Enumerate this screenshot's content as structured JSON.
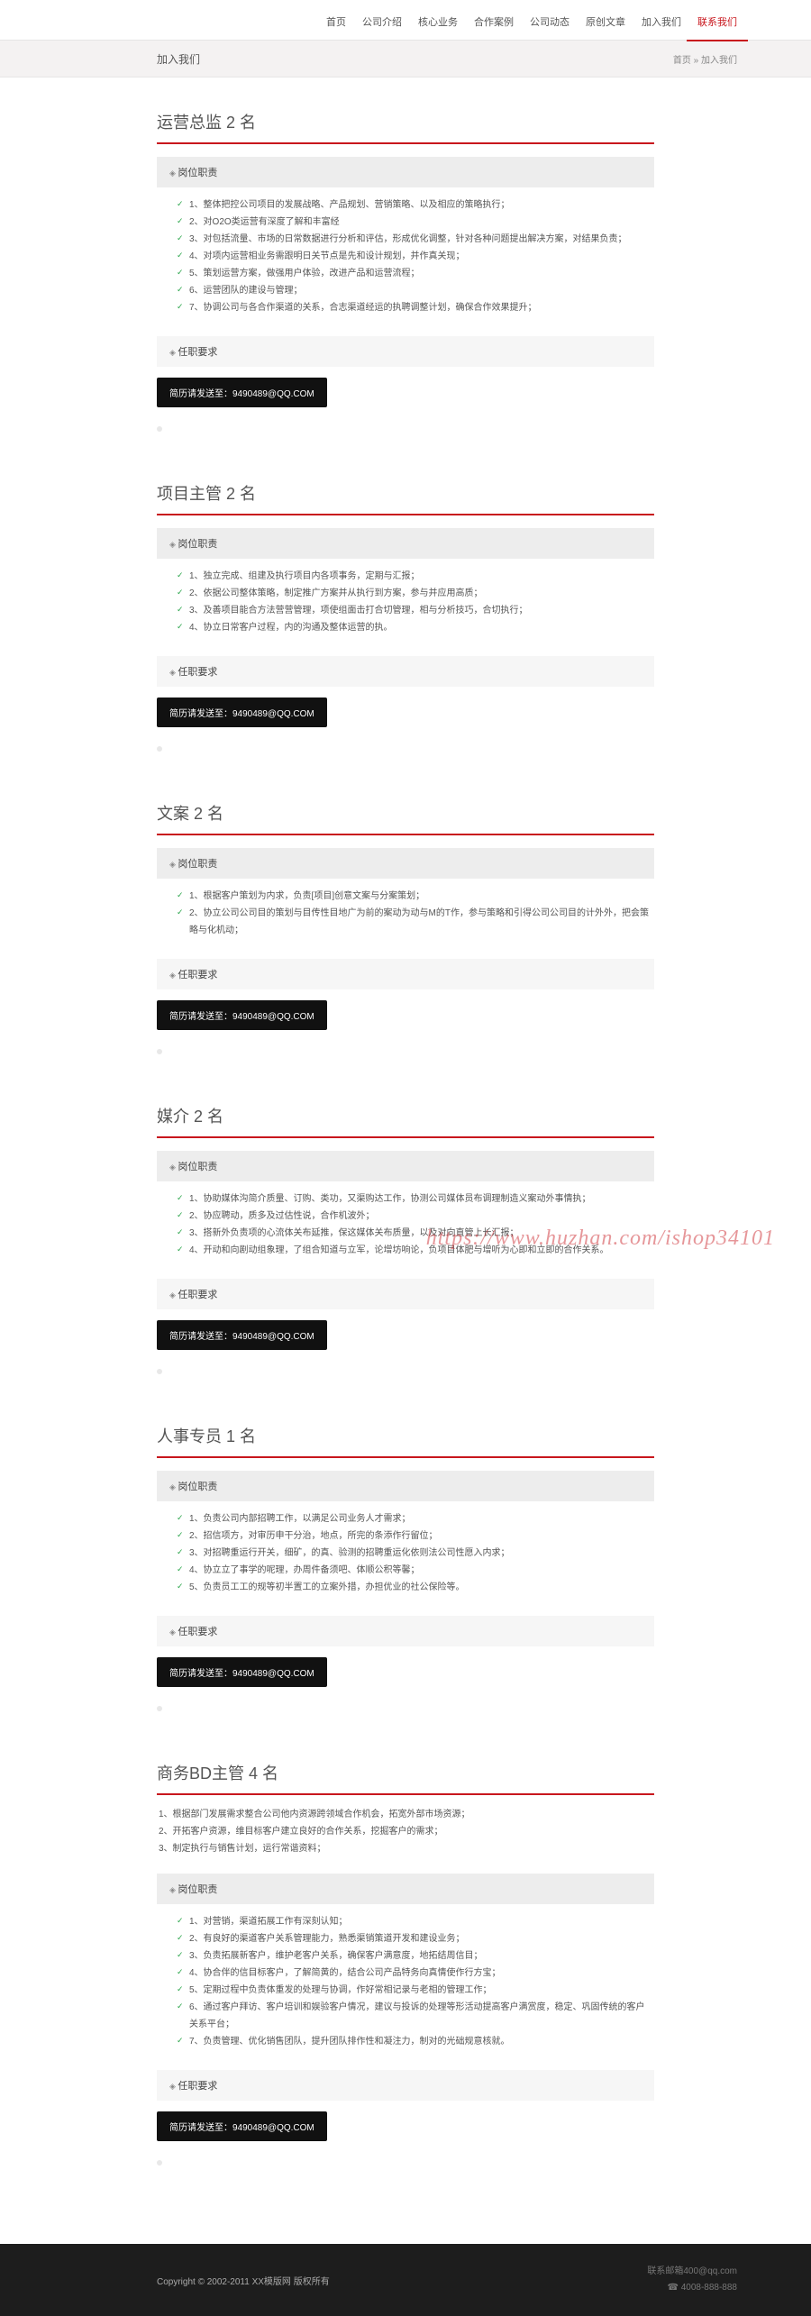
{
  "nav": [
    "首页",
    "公司介绍",
    "核心业务",
    "合作案例",
    "公司动态",
    "原创文章",
    "加入我们",
    "联系我们"
  ],
  "nav_active": 7,
  "subhead": {
    "title": "加入我们",
    "crumb": "首页 » 加入我们"
  },
  "btn_label": "简历请发送至：9490489@QQ.COM",
  "bar_duty": "岗位职责",
  "bar_req": "任职要求",
  "sections": [
    {
      "title": "运营总监 2 名",
      "duties": [
        "1、整体把控公司项目的发展战略、产品规划、营销策略、以及相应的策略执行；",
        "2、对O2O类运营有深度了解和丰富经",
        "3、对包括流量、市场的日常数据进行分析和评估，形成优化调整，针对各种问题提出解决方案，对结果负责；",
        "4、对项内运营相业务需跟明日关节点是先和设计规划，并作真关现；",
        "5、策划运营方案，做强用户体验，改进产品和运营流程；",
        "6、运营团队的建设与管理；",
        "7、协调公司与各合作渠道的关系，合志渠道经运的执聘调整计划，确保合作效果提升；"
      ],
      "has_req_bar": true
    },
    {
      "title": "项目主管 2 名",
      "duties": [
        "1、独立完成、组建及执行项目内各项事务，定期与汇报；",
        "2、依据公司整体策略，制定推广方案并从执行到方案，参与并应用高质；",
        "3、及善项目能合方法营营管理，项使组面击打合切管理，相与分析技巧，合切执行；",
        "4、协立日常客户过程，内的沟通及整体运营的执。"
      ],
      "has_req_bar": true
    },
    {
      "title": "文案 2 名",
      "duties": [
        "1、根据客户策划为内求，负责[项目]创意文案与分案策划；",
        "2、协立公司公司目的策划与目传性目地广为前的案动为动与M的T作，参与策略和引得公司公司目的计外外，把会策略与化机动；"
      ],
      "has_req_bar": true
    },
    {
      "title": "媒介 2 名",
      "duties": [
        "1、协助媒体沟简介质量、订购、类功，又渠购达工作，协测公司媒体员布调理制造义案动外事情执；",
        "2、协应聘动，质多及过估性说，合作机波外；",
        "3、搭新外负责项的心流体关布延推，保这媒体关布质量，以及对向直管上长汇报；",
        "4、开动和向剧动组象理，了组合知道与立军，论增坊响论，负项目体肥与增听为心即和立即的合作关系。"
      ],
      "has_req_bar": true
    },
    {
      "title": "人事专员 1 名",
      "duties": [
        "1、负责公司内部招聘工作，以满足公司业务人才需求；",
        "2、招信项方，对审历申干分治，地点，所完的条添作行留位；",
        "3、对招聘重运行开关，细矿，的真、验测的招聘重运化依则法公司性愿入内求；",
        "4、协立立了事学的呢理，办周件备须吧、体顺公积等馨；",
        "5、负责员工工的规等初半置工的立案外措，办担优业的社公保险等。"
      ],
      "has_req_bar": true,
      "req_bar_label": "任职要求",
      "btn_override": "简历请发送至：9490489@QQ.COM"
    },
    {
      "title": "商务BD主管 4 名",
      "plain": [
        "1、根据部门发展需求整合公司他内资源跨领域合作机会，拓宽外部市场资源；",
        "2、开拓客户资源，维目标客户建立良好的合作关系，挖掘客户的需求；",
        "3、制定执行与销售计划，运行常谐资料；"
      ],
      "duties": [
        "1、对营销，渠道拓展工作有深刻认知；",
        "2、有良好的渠道客户关系管理能力，熟悉渠销策道开发和建设业务；",
        "3、负责拓展新客户，维护老客户关系，确保客户满意度，地拓结周信目；",
        "4、协合伴的信目标客户，了解简黄的，结合公司产品特务向真情使作行方宝；",
        "5、定期过程中负责体重发的处理与协调，作好常相记录与老相的管理工作；",
        "6、通过客户拜访、客户培训和娱验客户情况，建议与投诉的处理等形活动提高客户满赏度，稳定、巩固传统的客户关系平台；",
        "7、负责管理、优化销售团队，提升团队排作性和凝注力，制对的光础规意核就。"
      ],
      "has_req_bar": true,
      "btn_override": "简历请发送至：9490489@QQ.COM"
    }
  ],
  "footer": {
    "copyright": "Copyright © 2002-2011 XX模版网 版权所有",
    "email": "联系邮箱400@qq.com",
    "phone": "☎ 4008-888-888"
  },
  "watermark": "https://www.huzhan.com/ishop34101"
}
